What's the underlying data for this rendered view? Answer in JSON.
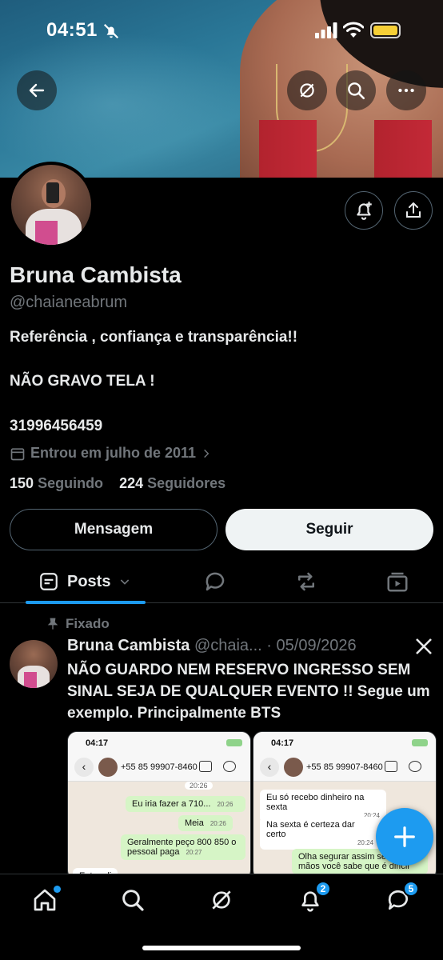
{
  "status_bar": {
    "time": "04:51"
  },
  "header": {
    "back_icon": "arrow-left-icon",
    "actions": [
      "grok-icon",
      "search-icon",
      "more-icon"
    ]
  },
  "profile": {
    "name": "Bruna Cambista",
    "handle": "@chaianeabrum",
    "bio_lines": [
      "Referência , confiança e transparência!!",
      "NÃO GRAVO TELA !",
      "31996456459"
    ],
    "joined": "Entrou em julho de 2011",
    "following_count": "150",
    "following_label": "Seguindo",
    "followers_count": "224",
    "followers_label": "Seguidores",
    "message_button": "Mensagem",
    "follow_button": "Seguir"
  },
  "tabs": {
    "active": "Posts",
    "icons": [
      "reply-icon",
      "repost-icon",
      "video-icon"
    ]
  },
  "post": {
    "pinned_label": "Fixado",
    "author": "Bruna Cambista",
    "handle": "@chaia...",
    "date": "· 05/09/2026",
    "text": "NÃO GUARDO NEM RESERVO INGRESSO SEM SINAL SEJA DE QUALQUER EVENTO !! Segue um exemplo. Principalmente BTS",
    "screenshot1": {
      "time": "04:17",
      "battery": "31+",
      "contact": "+55 85 99907-8460",
      "messages": [
        {
          "text": "20:26",
          "type": "ts"
        },
        {
          "text": "Eu iria fazer a 710...",
          "time": "20:26",
          "type": "out"
        },
        {
          "text": "Meia",
          "time": "20:26",
          "type": "out"
        },
        {
          "text": "Geralmente peço 800 850 o pessoal paga",
          "time": "20:27",
          "type": "out"
        },
        {
          "text": "Entao di",
          "type": "in"
        }
      ]
    },
    "screenshot2": {
      "time": "04:17",
      "battery": "31+",
      "contact": "+55 85 99907-8460",
      "messages": [
        {
          "text": "Eu só recebo dinheiro na sexta",
          "time": "20:24",
          "type": "in"
        },
        {
          "text": "Na sexta é certeza dar certo",
          "time": "20:24",
          "type": "in"
        },
        {
          "text": "Olha segurar assim sem nas mãos você sabe que é difícil",
          "type": "out"
        }
      ]
    }
  },
  "bottom_nav": {
    "items": [
      "home-icon",
      "search-icon",
      "grok-icon",
      "notifications-icon",
      "messages-icon"
    ],
    "notifications_badge": "2",
    "messages_badge": "5"
  },
  "colors": {
    "accent": "#1d9bf0",
    "muted": "#71767b",
    "text": "#e7e9ea",
    "border": "#2f3336"
  }
}
